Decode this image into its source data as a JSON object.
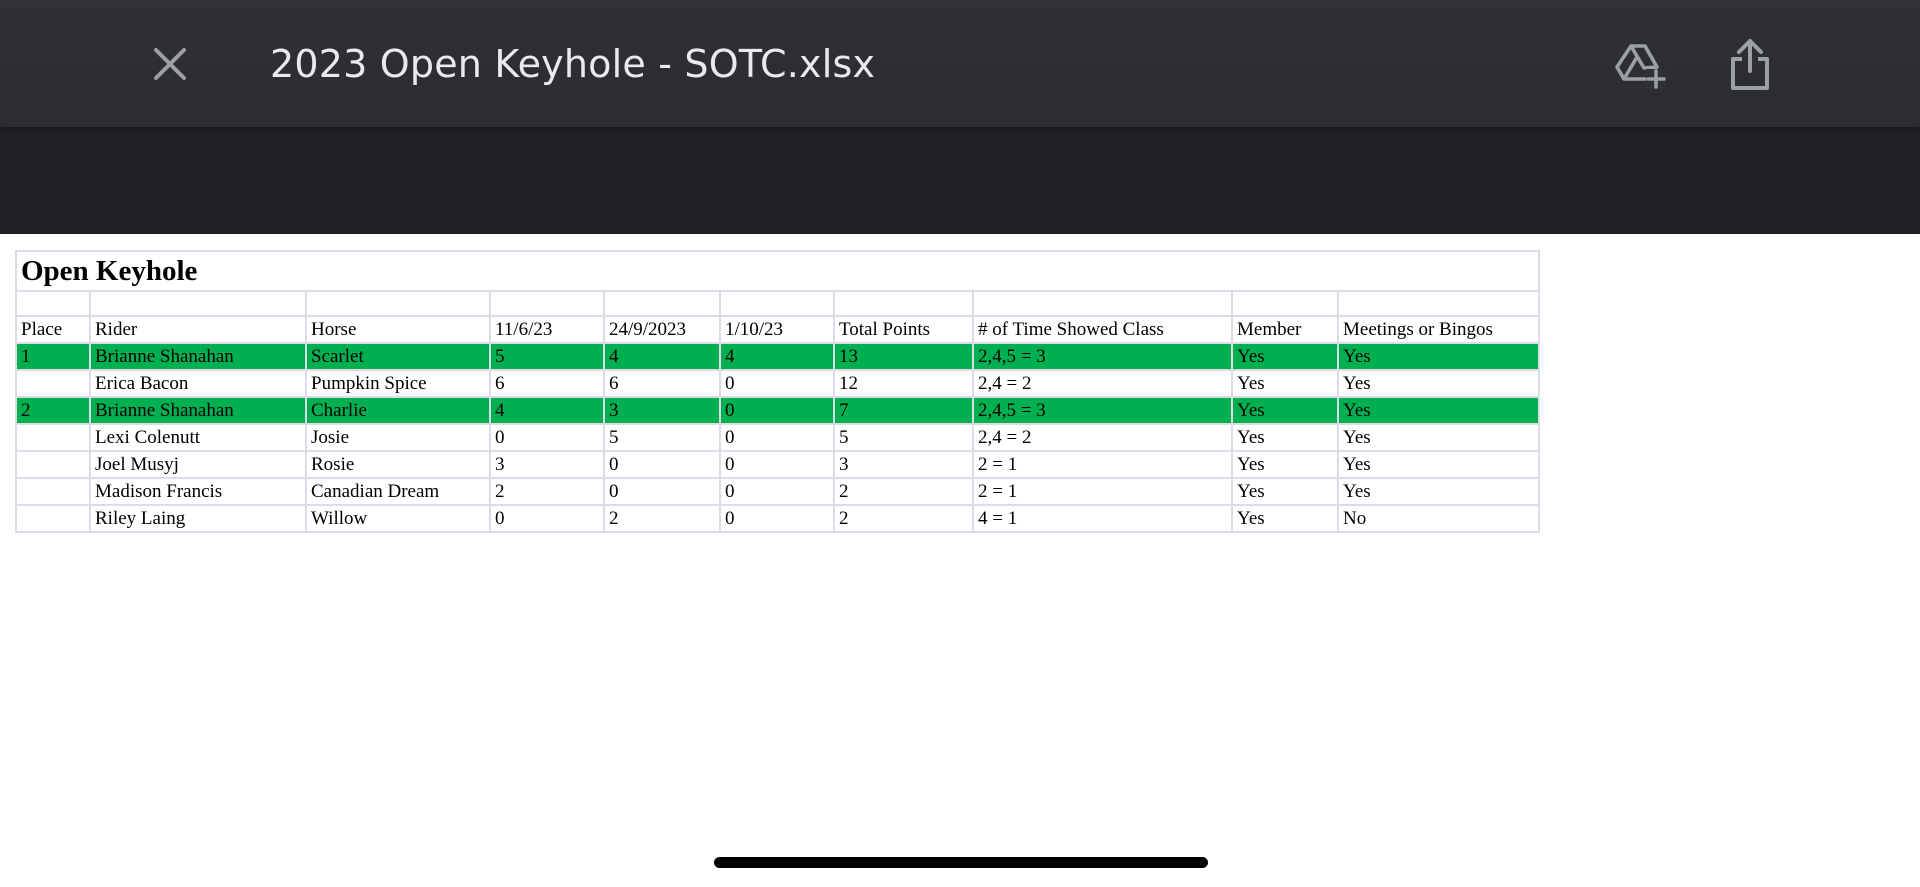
{
  "header": {
    "title": "2023 Open Keyhole - SOTC.xlsx",
    "close_icon": "close-icon",
    "drive_icon": "add-to-drive-icon",
    "share_icon": "share-icon"
  },
  "sheet": {
    "title": "Open Keyhole",
    "columns": [
      "Place",
      "Rider",
      "Horse",
      "11/6/23",
      "24/9/2023",
      "1/10/23",
      "Total Points",
      "# of Time Showed Class",
      "Member",
      "Meetings or Bingos"
    ],
    "rows": [
      {
        "cells": [
          "1",
          "Brianne Shanahan",
          "Scarlet",
          "5",
          "4",
          "4",
          "13",
          "2,4,5 = 3",
          "Yes",
          "Yes"
        ],
        "highlight": true
      },
      {
        "cells": [
          "",
          "Erica Bacon",
          "Pumpkin Spice",
          "6",
          "6",
          "0",
          "12",
          "2,4 = 2",
          "Yes",
          "Yes"
        ],
        "highlight": false
      },
      {
        "cells": [
          "2",
          "Brianne Shanahan",
          "Charlie",
          "4",
          "3",
          "0",
          "7",
          "2,4,5 = 3",
          "Yes",
          "Yes"
        ],
        "highlight": true
      },
      {
        "cells": [
          "",
          "Lexi Colenutt",
          "Josie",
          "0",
          "5",
          "0",
          "5",
          "2,4 = 2",
          "Yes",
          "Yes"
        ],
        "highlight": false
      },
      {
        "cells": [
          "",
          "Joel Musyj",
          "Rosie",
          "3",
          "0",
          "0",
          "3",
          "2 = 1",
          "Yes",
          "Yes"
        ],
        "highlight": false
      },
      {
        "cells": [
          "",
          "Madison Francis",
          "Canadian Dream",
          "2",
          "0",
          "0",
          "2",
          "2 = 1",
          "Yes",
          "Yes"
        ],
        "highlight": false
      },
      {
        "cells": [
          "",
          "Riley Laing",
          "Willow",
          "0",
          "2",
          "0",
          "2",
          "4 = 1",
          "Yes",
          "No"
        ],
        "highlight": false
      }
    ],
    "highlight_color": "#00b050",
    "grid_color": "#dadce8"
  },
  "colors": {
    "topbar": "#303134",
    "band": "#202124",
    "title_text": "#e8eaed",
    "icon": "#9aa0a6"
  }
}
